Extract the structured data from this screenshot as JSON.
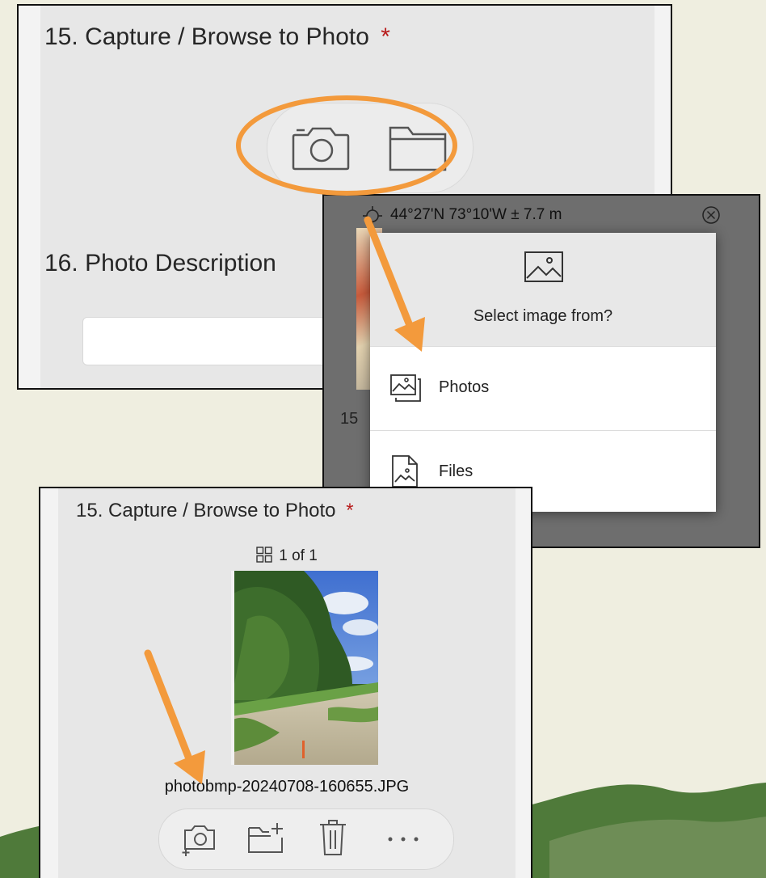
{
  "panel_top": {
    "question_15": {
      "number": "15.",
      "label": "Capture / Browse to Photo",
      "required_mark": "*"
    },
    "question_16": {
      "number": "16.",
      "label": "Photo Description"
    },
    "icons": [
      "camera-icon",
      "folder-icon"
    ]
  },
  "picker": {
    "location": "44°27'N 73°10'W ± 7.7 m",
    "behind_label": "15",
    "title": "Select image from?",
    "options": [
      {
        "label": "Photos",
        "icon": "photos-icon"
      },
      {
        "label": "Files",
        "icon": "image-file-icon"
      }
    ]
  },
  "panel_result": {
    "question_15": {
      "number": "15.",
      "label": "Capture / Browse to Photo",
      "required_mark": "*"
    },
    "counter": "1 of 1",
    "filename": "photobmp-20240708-160655.JPG",
    "toolbar_icons": [
      "add-camera-icon",
      "add-folder-icon",
      "trash-icon",
      "more-icon"
    ]
  },
  "colors": {
    "accent_orange": "#f39a3c",
    "required_red": "#b81c1c",
    "hill_dark": "#4f7a3a",
    "hill_light": "#6e8d56",
    "background": "#efeee0"
  }
}
